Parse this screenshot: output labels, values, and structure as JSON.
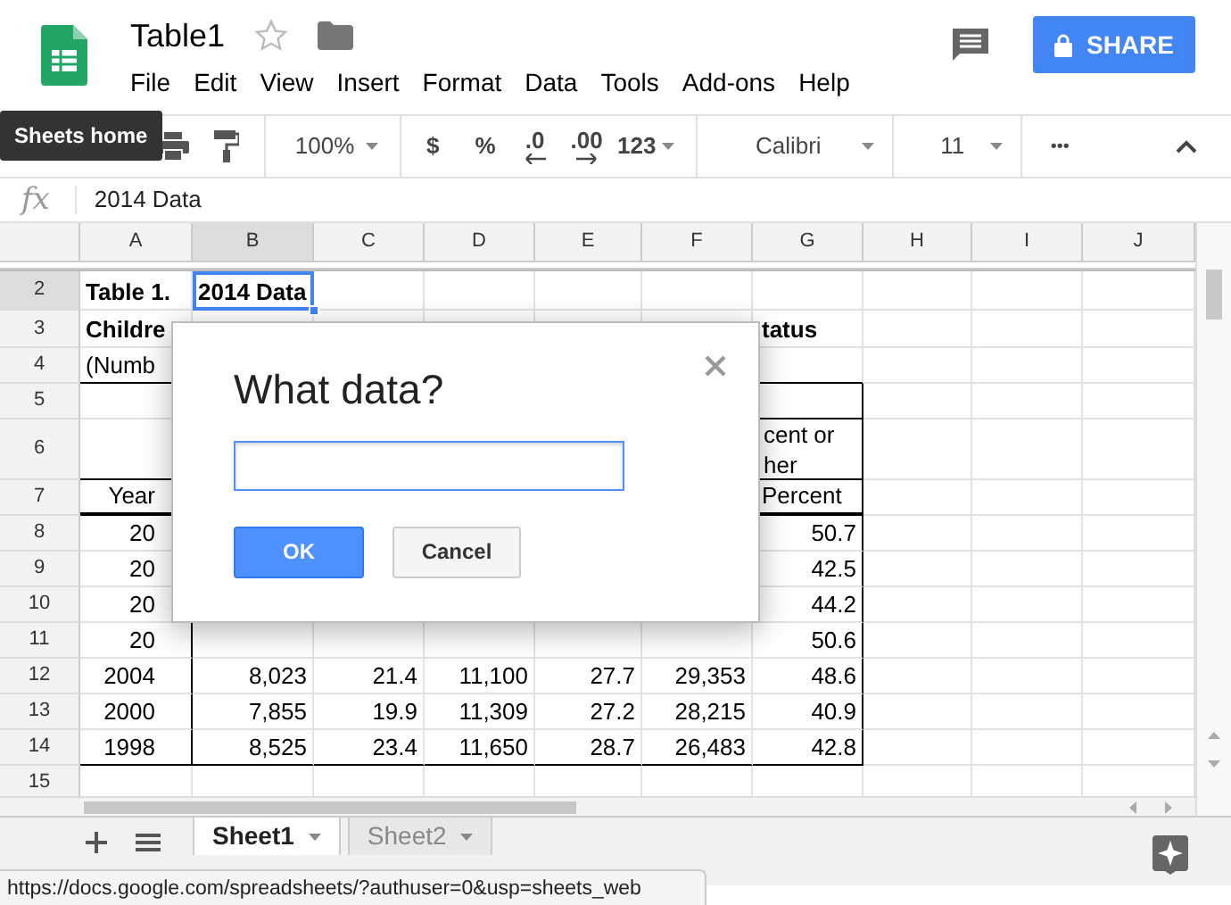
{
  "document": {
    "title": "Table1"
  },
  "menu": [
    "File",
    "Edit",
    "View",
    "Insert",
    "Format",
    "Data",
    "Tools",
    "Add-ons",
    "Help"
  ],
  "share_button": {
    "label": "SHARE"
  },
  "tooltip": "Sheets home",
  "toolbar": {
    "zoom": "100%",
    "currency": "$",
    "percent": "%",
    "decrease_decimals": ".0",
    "increase_decimals": ".00",
    "number_format": "123",
    "font": "Calibri",
    "font_size": "11",
    "more": "•••"
  },
  "formula_bar": {
    "fx": "fx",
    "value": "2014 Data"
  },
  "columns": [
    {
      "label": "A",
      "selected": false
    },
    {
      "label": "B",
      "selected": true
    },
    {
      "label": "C",
      "selected": false
    },
    {
      "label": "D",
      "selected": false
    },
    {
      "label": "E",
      "selected": false
    },
    {
      "label": "F",
      "selected": false
    },
    {
      "label": "G",
      "selected": false
    },
    {
      "label": "H",
      "selected": false
    },
    {
      "label": "I",
      "selected": false
    },
    {
      "label": "J",
      "selected": false
    }
  ],
  "rows": [
    {
      "label": "2",
      "selected": true,
      "cells": [
        "Table 1.",
        "2014 Data"
      ]
    },
    {
      "label": "3",
      "selected": false,
      "cells": [
        "Childre",
        null,
        null,
        null,
        null,
        null,
        "tatus"
      ]
    },
    {
      "label": "4",
      "selected": false,
      "cells": [
        "(Numb"
      ]
    },
    {
      "label": "5",
      "selected": false,
      "cells": []
    },
    {
      "label": "6",
      "selected": false,
      "cells": [
        null,
        null,
        null,
        null,
        null,
        null,
        "cent or her"
      ]
    },
    {
      "label": "7",
      "selected": false,
      "cells": [
        "Year",
        null,
        null,
        null,
        null,
        null,
        "Percent"
      ]
    },
    {
      "label": "8",
      "selected": false,
      "cells": [
        "20",
        null,
        null,
        null,
        null,
        null,
        "50.7"
      ]
    },
    {
      "label": "9",
      "selected": false,
      "cells": [
        "20",
        null,
        null,
        null,
        null,
        null,
        "42.5"
      ]
    },
    {
      "label": "10",
      "selected": false,
      "cells": [
        "20",
        null,
        null,
        null,
        null,
        null,
        "44.2"
      ]
    },
    {
      "label": "11",
      "selected": false,
      "cells": [
        "20",
        null,
        null,
        null,
        null,
        null,
        "50.6"
      ]
    },
    {
      "label": "12",
      "selected": false,
      "cells": [
        "2004",
        "8,023",
        "21.4",
        "11,100",
        "27.7",
        "29,353",
        "48.6"
      ]
    },
    {
      "label": "13",
      "selected": false,
      "cells": [
        "2000",
        "7,855",
        "19.9",
        "11,309",
        "27.2",
        "28,215",
        "40.9"
      ]
    },
    {
      "label": "14",
      "selected": false,
      "cells": [
        "1998",
        "8,525",
        "23.4",
        "11,650",
        "28.7",
        "26,483",
        "42.8"
      ]
    },
    {
      "label": "15",
      "selected": false,
      "cells": []
    }
  ],
  "dialog": {
    "title": "What data?",
    "buttons": [
      {
        "label": "OK",
        "kind": "primary"
      },
      {
        "label": "Cancel",
        "kind": "secondary"
      }
    ]
  },
  "sheet_tabs": [
    {
      "label": "Sheet1",
      "selected": true
    },
    {
      "label": "Sheet2",
      "selected": false
    }
  ],
  "status_url": "https://docs.google.com/spreadsheets/?authuser=0&usp=sheets_web"
}
